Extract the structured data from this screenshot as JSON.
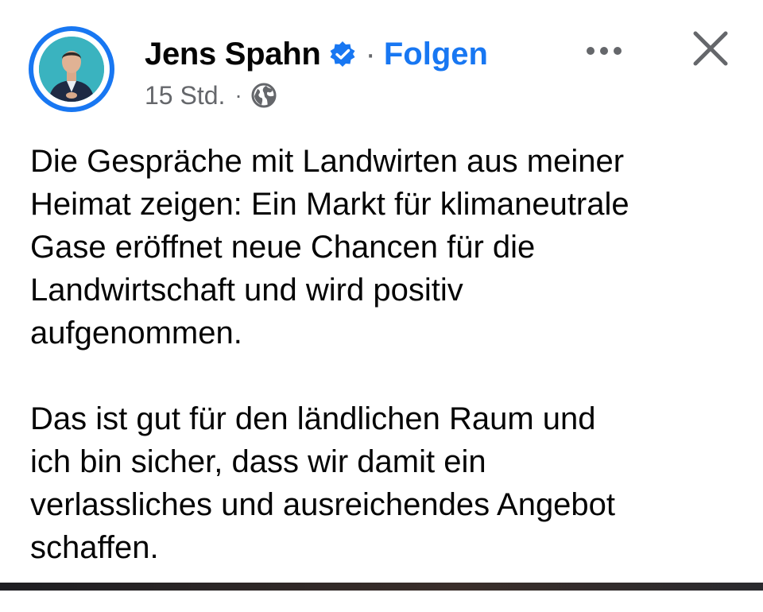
{
  "post": {
    "author": {
      "name": "Jens Spahn",
      "verified": true
    },
    "follow_label": "Folgen",
    "separator": "·",
    "timestamp": "15 Std.",
    "meta_separator": "·",
    "privacy_icon": "globe-icon",
    "more_icon": "more-dots-icon",
    "close_icon": "close-x-icon",
    "paragraphs": [
      "Die Gespräche mit Landwirten aus meiner\nHeimat zeigen: Ein Markt für klimaneutrale\nGase eröffnet neue Chancen für die\nLandwirtschaft und wird positiv\naufgenommen.",
      "Das ist gut für den ländlichen Raum und\nich bin sicher, dass wir damit ein\nverlassliches und ausreichendes Angebot\nschaffen."
    ]
  },
  "colors": {
    "accent": "#1877f2",
    "secondary_text": "#65676b",
    "primary_text": "#050505",
    "background": "#ffffff"
  }
}
